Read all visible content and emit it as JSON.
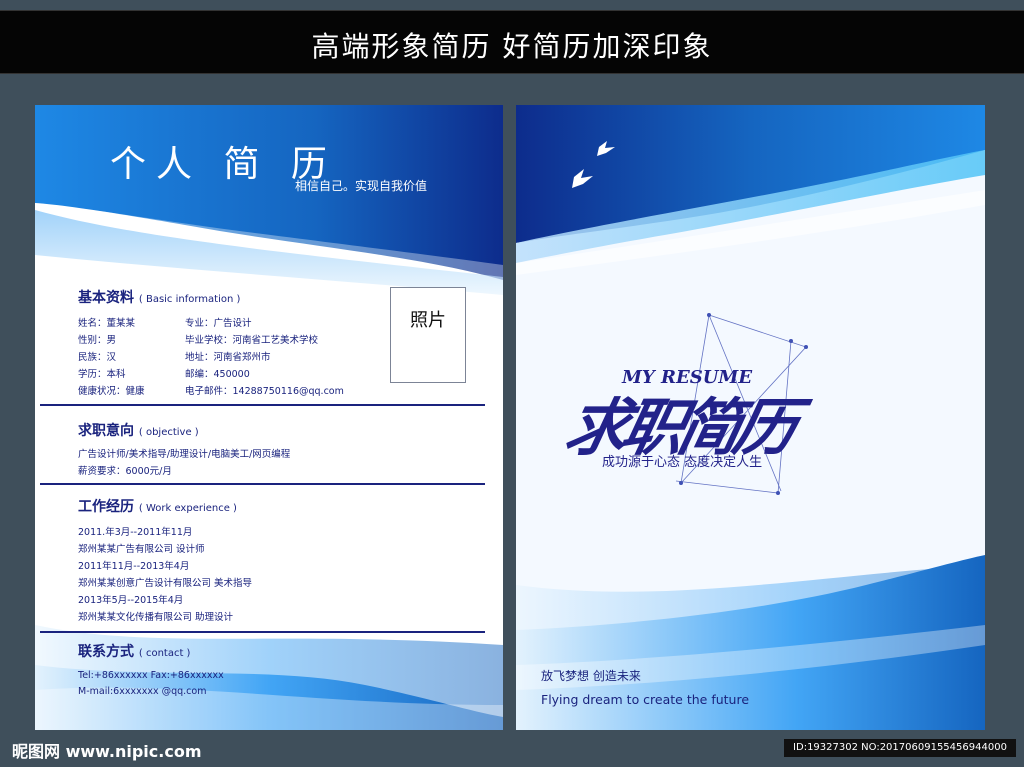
{
  "banner": {
    "title": "高端形象简历  好简历加深印象"
  },
  "left_page": {
    "title": "个人 简 历",
    "subtitle": "相信自己。实现自我价值",
    "photo_label": "照片",
    "basic": {
      "heading": "基本资料",
      "heading_en": "( Basic information )",
      "col1": [
        "姓名：董某某",
        "性别：男",
        "民族：汉",
        "学历：本科",
        "健康状况：健康"
      ],
      "col2": [
        "专业：广告设计",
        "毕业学校：河南省工艺美术学校",
        "地址：河南省郑州市",
        "邮编：450000",
        "电子邮件：14288750116@qq.com"
      ]
    },
    "objective": {
      "heading": "求职意向",
      "heading_en": "( objective )",
      "lines": [
        "广告设计师/美术指导/助理设计/电脑美工/网页编程",
        "薪资要求：6000元/月"
      ]
    },
    "experience": {
      "heading": "工作经历",
      "heading_en": "( Work experience )",
      "lines": [
        "2011.年3月--2011年11月",
        "郑州某某广告有限公司  设计师",
        "2011年11月--2013年4月",
        "郑州某某创意广告设计有限公司  美术指导",
        "2013年5月--2015年4月",
        "郑州某某文化传播有限公司 助理设计"
      ]
    },
    "contact": {
      "heading": "联系方式",
      "heading_en": "( contact )",
      "lines": [
        "Tel:+86xxxxxx Fax:+86xxxxxx",
        "M-mail:6xxxxxxx @qq.com"
      ]
    }
  },
  "right_page": {
    "my_resume": "MY RESUME",
    "big_title": "求职简历",
    "slogan": "成功源于心态 态度决定人生",
    "footer_cn": "放飞梦想  创造未来",
    "footer_en": "Flying dream to create the future"
  },
  "watermark": {
    "site": "昵图网 www.nipic.com",
    "id": "ID:19327302 NO:20170609155456944000"
  },
  "colors": {
    "navy": "#1a237e",
    "blue": "#1565c0",
    "sky": "#42a5f5",
    "bg": "#3f4f5b"
  }
}
